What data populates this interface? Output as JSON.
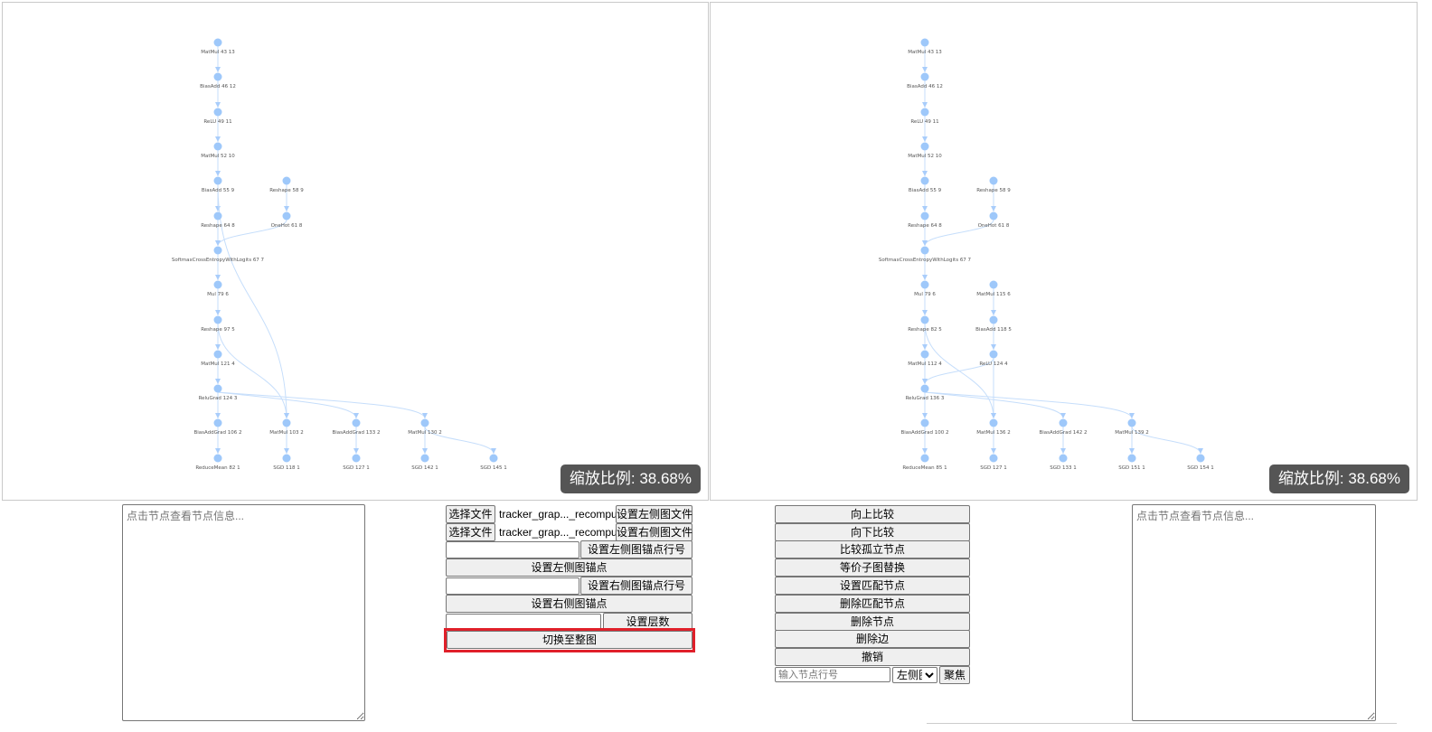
{
  "left_graph": {
    "zoom_label": "缩放比例: 38.68%",
    "nodes": [
      {
        "id": "l0",
        "label": "MatMul 43 13"
      },
      {
        "id": "l1",
        "label": "BiasAdd 46 12"
      },
      {
        "id": "l2",
        "label": "ReLU 49 11"
      },
      {
        "id": "l3",
        "label": "MatMul 52 10"
      },
      {
        "id": "l4",
        "label": "BiasAdd 55 9"
      },
      {
        "id": "l5",
        "label": "Reshape 58 9"
      },
      {
        "id": "l6",
        "label": "Reshape 64 8"
      },
      {
        "id": "l7",
        "label": "OneHot 61 8"
      },
      {
        "id": "l8",
        "label": "SoftmaxCrossEntropyWithLogits 67 7"
      },
      {
        "id": "l9",
        "label": "Mul 79 6"
      },
      {
        "id": "l10",
        "label": "Reshape 97 5"
      },
      {
        "id": "l11",
        "label": "MatMul 121 4"
      },
      {
        "id": "l12",
        "label": "ReluGrad 124 3"
      },
      {
        "id": "l13",
        "label": "BiasAddGrad 106 2"
      },
      {
        "id": "l14",
        "label": "MatMul 103 2"
      },
      {
        "id": "l15",
        "label": "BiasAddGrad 133 2"
      },
      {
        "id": "l16",
        "label": "MatMul 130 2"
      },
      {
        "id": "l17",
        "label": "ReduceMean 82 1"
      },
      {
        "id": "l18",
        "label": "SGD 118 1"
      },
      {
        "id": "l19",
        "label": "SGD 127 1"
      },
      {
        "id": "l20",
        "label": "SGD 142 1"
      },
      {
        "id": "l21",
        "label": "SGD 145 1"
      }
    ]
  },
  "right_graph": {
    "zoom_label": "缩放比例: 38.68%",
    "nodes": [
      {
        "id": "r0",
        "label": "MatMul 43 13"
      },
      {
        "id": "r1",
        "label": "BiasAdd 46 12"
      },
      {
        "id": "r2",
        "label": "ReLU 49 11"
      },
      {
        "id": "r3",
        "label": "MatMul 52 10"
      },
      {
        "id": "r4",
        "label": "BiasAdd 55 9"
      },
      {
        "id": "r5",
        "label": "Reshape 58 9"
      },
      {
        "id": "r6",
        "label": "Reshape 64 8"
      },
      {
        "id": "r7",
        "label": "OneHot 61 8"
      },
      {
        "id": "r8",
        "label": "SoftmaxCrossEntropyWithLogits 67 7"
      },
      {
        "id": "r9",
        "label": "Mul 79 6"
      },
      {
        "id": "r10",
        "label": "MatMul 115 6"
      },
      {
        "id": "r11",
        "label": "Reshape 82 5"
      },
      {
        "id": "r12",
        "label": "BiasAdd 118 5"
      },
      {
        "id": "r13",
        "label": "MatMul 112 4"
      },
      {
        "id": "r14",
        "label": "ReLU 124 4"
      },
      {
        "id": "r15",
        "label": "ReluGrad 136 3"
      },
      {
        "id": "r16",
        "label": "BiasAddGrad 100 2"
      },
      {
        "id": "r17",
        "label": "MatMul 136 2"
      },
      {
        "id": "r18",
        "label": "BiasAddGrad 142 2"
      },
      {
        "id": "r19",
        "label": "MatMul 139 2"
      },
      {
        "id": "r20",
        "label": "ReduceMean 85 1"
      },
      {
        "id": "r21",
        "label": "SGD 127 1"
      },
      {
        "id": "r22",
        "label": "SGD 133 1"
      },
      {
        "id": "r23",
        "label": "SGD 151 1"
      },
      {
        "id": "r24",
        "label": "SGD 154 1"
      }
    ]
  },
  "left_info": {
    "placeholder": "点击节点查看节点信息..."
  },
  "right_info": {
    "placeholder": "点击节点查看节点信息..."
  },
  "controls": {
    "choose_file_1": "选择文件",
    "file_name_1": "tracker_grap..._recompute.ir",
    "set_left_file": "设置左侧图文件",
    "choose_file_2": "选择文件",
    "file_name_2": "tracker_grap..._recompute.ir",
    "set_right_file": "设置右侧图文件",
    "set_left_anchor_line": "设置左侧图锚点行号",
    "set_left_anchor": "设置左侧图锚点",
    "set_right_anchor_line": "设置右侧图锚点行号",
    "set_right_anchor": "设置右侧图锚点",
    "set_layers": "设置层数",
    "switch_full_graph": "切换至整图"
  },
  "actions": {
    "compare_up": "向上比较",
    "compare_down": "向下比较",
    "compare_isolated": "比较孤立节点",
    "equiv_subgraph_replace": "等价子图替换",
    "set_match_node": "设置匹配节点",
    "delete_match_node": "删除匹配节点",
    "delete_node": "删除节点",
    "delete_edge": "删除边",
    "undo": "撤销",
    "node_line_placeholder": "输入节点行号",
    "side_select_value": "左侧图",
    "focus": "聚焦"
  }
}
